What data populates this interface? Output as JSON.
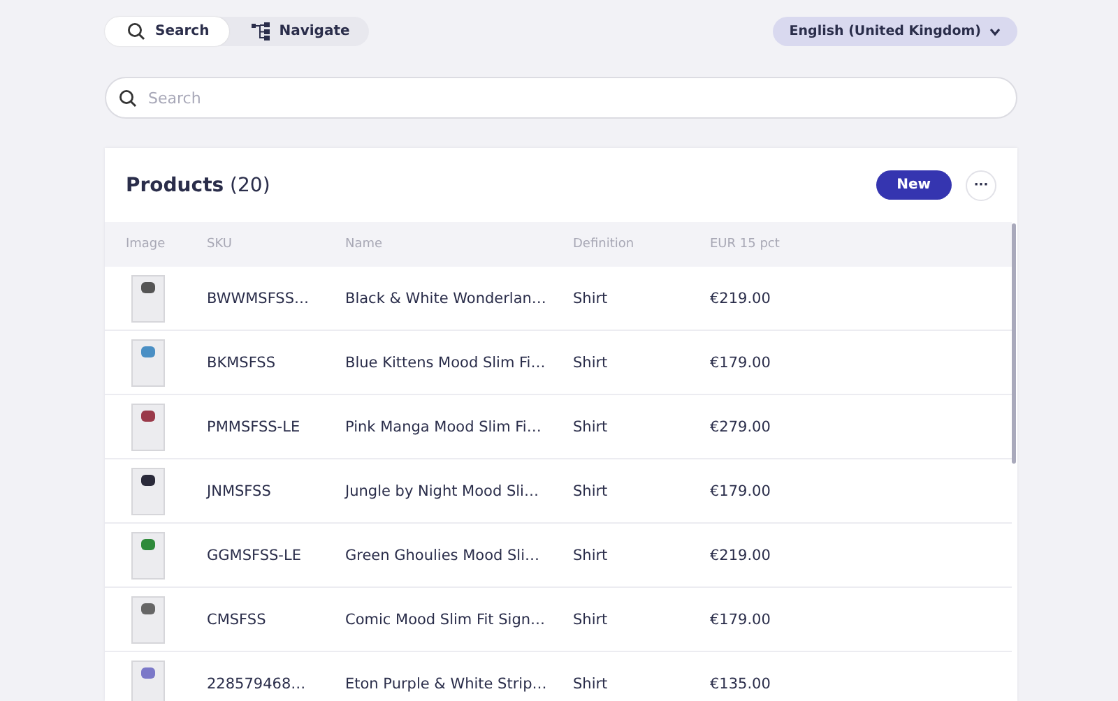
{
  "mode_tabs": [
    {
      "label": "Search",
      "kind": "search",
      "selected": true
    },
    {
      "label": "Navigate",
      "kind": "tree",
      "selected": false
    }
  ],
  "language": {
    "label": "English (United Kingdom)"
  },
  "search": {
    "placeholder": "Search"
  },
  "products": {
    "title": "Products",
    "count": "(20)",
    "new_button": "New",
    "more_button": "···",
    "columns": [
      "Image",
      "SKU",
      "Name",
      "Definition",
      "EUR 15 pct"
    ],
    "rows": [
      {
        "sku": "BWWMSFSS…",
        "name": "Black & White Wonderlan…",
        "definition": "Shirt",
        "price": "€219.00",
        "color": "#555555"
      },
      {
        "sku": "BKMSFSS",
        "name": "Blue Kittens Mood Slim Fi…",
        "definition": "Shirt",
        "price": "€179.00",
        "color": "#4a8fc4"
      },
      {
        "sku": "PMMSFSS-LE",
        "name": "Pink Manga Mood Slim Fi…",
        "definition": "Shirt",
        "price": "€279.00",
        "color": "#9a3a4a"
      },
      {
        "sku": "JNMSFSS",
        "name": "Jungle by Night Mood Sli…",
        "definition": "Shirt",
        "price": "€179.00",
        "color": "#2a2a3a"
      },
      {
        "sku": "GGMSFSS-LE",
        "name": "Green Ghoulies Mood Sli…",
        "definition": "Shirt",
        "price": "€219.00",
        "color": "#2e8a3a"
      },
      {
        "sku": "CMSFSS",
        "name": "Comic Mood Slim Fit Sign…",
        "definition": "Shirt",
        "price": "€179.00",
        "color": "#666666"
      },
      {
        "sku": "228579468…",
        "name": "Eton Purple & White Strip…",
        "definition": "Shirt",
        "price": "€135.00",
        "color": "#7b78c8"
      }
    ]
  }
}
